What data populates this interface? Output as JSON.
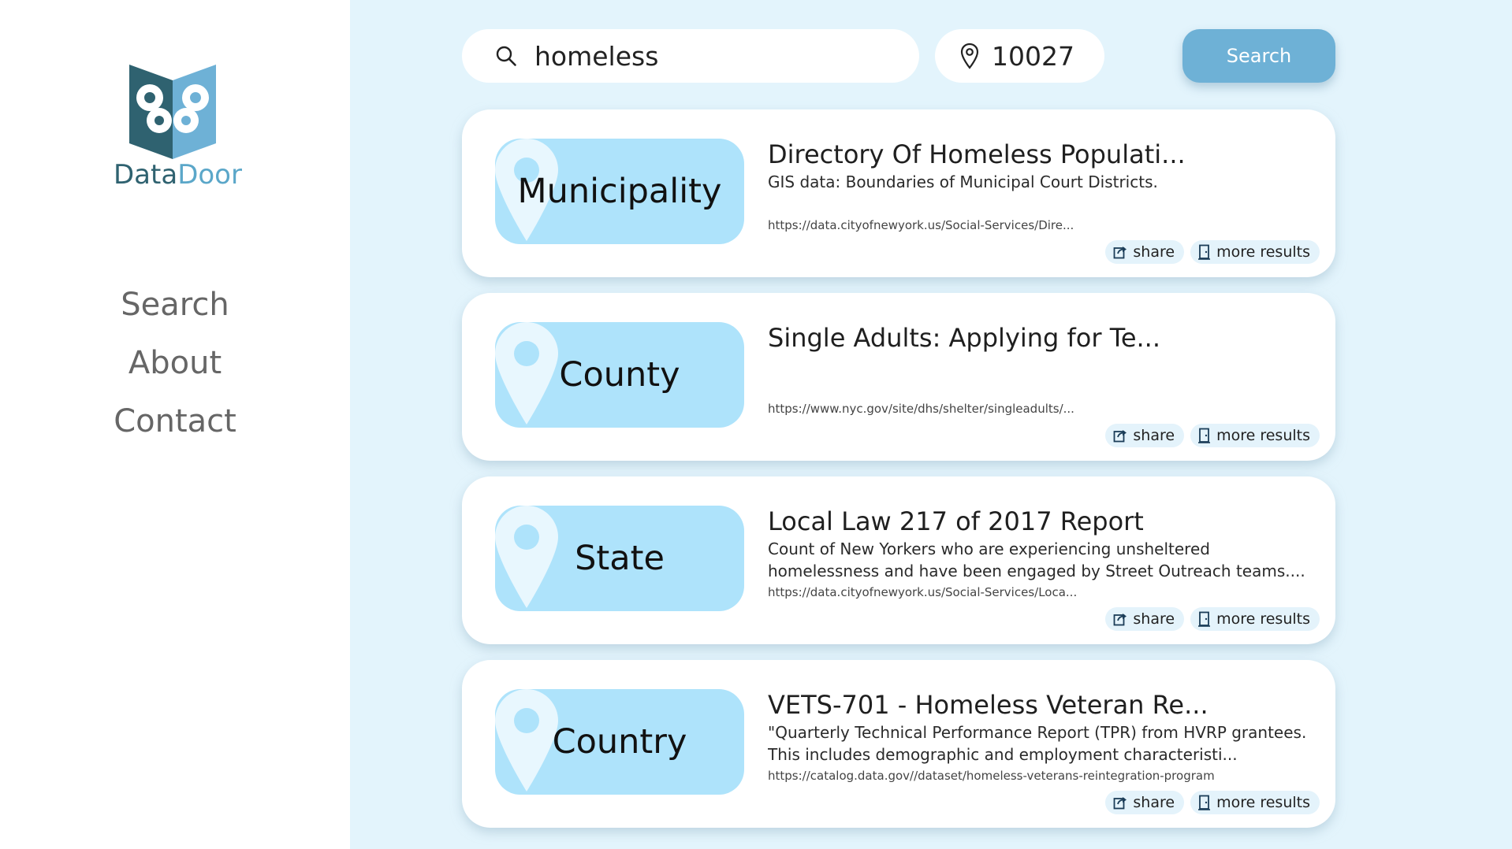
{
  "brand": {
    "name_part1": "Data",
    "name_part2": "Door",
    "logo_icon": "data-door-logo"
  },
  "nav": {
    "items": [
      {
        "label": "Search"
      },
      {
        "label": "About"
      },
      {
        "label": "Contact"
      }
    ]
  },
  "search": {
    "query": "homeless",
    "zip": "10027",
    "button_label": "Search",
    "search_icon": "search-icon",
    "location_icon": "location-pin-icon"
  },
  "colors": {
    "background": "#e3f4fc",
    "accent": "#6eb1d6",
    "pill": "#aee3fb",
    "chip": "#e4f3fb",
    "logo_dark": "#2f6270",
    "logo_light": "#5ba7c9"
  },
  "results": [
    {
      "scope": "Municipality",
      "title": "Directory Of Homeless Populati...",
      "description": "GIS data: Boundaries of Municipal Court Districts.",
      "url": "https://data.cityofnewyork.us/Social-Services/Dire...",
      "share_label": "share",
      "more_label": "more results"
    },
    {
      "scope": "County",
      "title": "Single Adults: Applying for Te...",
      "description": "",
      "url": "https://www.nyc.gov/site/dhs/shelter/singleadults/...",
      "share_label": "share",
      "more_label": "more results"
    },
    {
      "scope": "State",
      "title": "Local Law 217 of 2017 Report",
      "description": "Count of New Yorkers who are experiencing unsheltered homelessness and have been engaged by Street Outreach teams....",
      "url": "https://data.cityofnewyork.us/Social-Services/Loca...",
      "share_label": "share",
      "more_label": "more results"
    },
    {
      "scope": "Country",
      "title": "VETS-701 - Homeless Veteran Re...",
      "description": "\"Quarterly Technical Performance Report (TPR) from HVRP grantees. This includes demographic and employment characteristi...",
      "url": "https://catalog.data.gov//dataset/homeless-veterans-reintegration-program",
      "share_label": "share",
      "more_label": "more results"
    }
  ]
}
